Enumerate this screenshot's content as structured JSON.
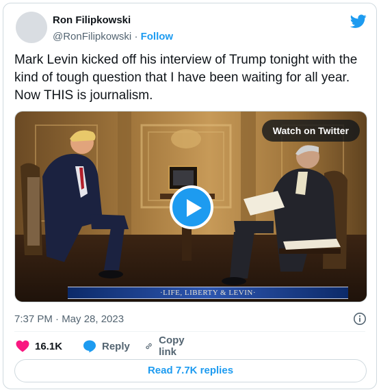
{
  "author": {
    "name": "Ron Filipkowski",
    "handle": "@RonFilipkowski",
    "separator": "·",
    "follow_label": "Follow"
  },
  "tweet": {
    "text": "Mark Levin kicked off his interview of Trump tonight with the kind of tough question that I have been waiting for all year. Now THIS is journalism.",
    "timestamp": "7:37 PM · May 28, 2023"
  },
  "media": {
    "watch_label": "Watch on Twitter",
    "chyron": "·LIFE, LIBERTY & LEVIN·"
  },
  "actions": {
    "likes_count": "16.1K",
    "reply_label": "Reply",
    "copy_link_label": "Copy link"
  },
  "read_replies_label": "Read 7.7K replies",
  "icons": {
    "brand": "twitter-bird-icon",
    "info": "info-icon",
    "like": "heart-icon",
    "reply": "reply-bubble-icon",
    "copy": "link-icon",
    "play": "play-icon"
  },
  "colors": {
    "accent": "#1d9bf0",
    "like": "#f91880",
    "text": "#0f1419",
    "secondary": "#536471",
    "border": "#cfd9de"
  }
}
